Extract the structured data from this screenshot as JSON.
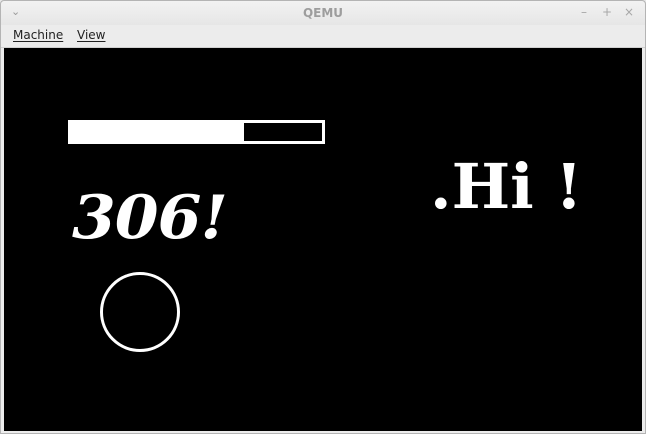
{
  "window": {
    "title": "QEMU",
    "menu_glyph": "⌄",
    "controls": {
      "minimize": "–",
      "maximize": "+",
      "close": "×"
    }
  },
  "menubar": {
    "items": [
      {
        "label": "Machine"
      },
      {
        "label": "View"
      }
    ]
  },
  "screen": {
    "progress_fraction": 0.69,
    "score_text": "306!",
    "greeting_text": ".Hi !",
    "colors": {
      "background": "#000000",
      "foreground": "#ffffff"
    }
  }
}
